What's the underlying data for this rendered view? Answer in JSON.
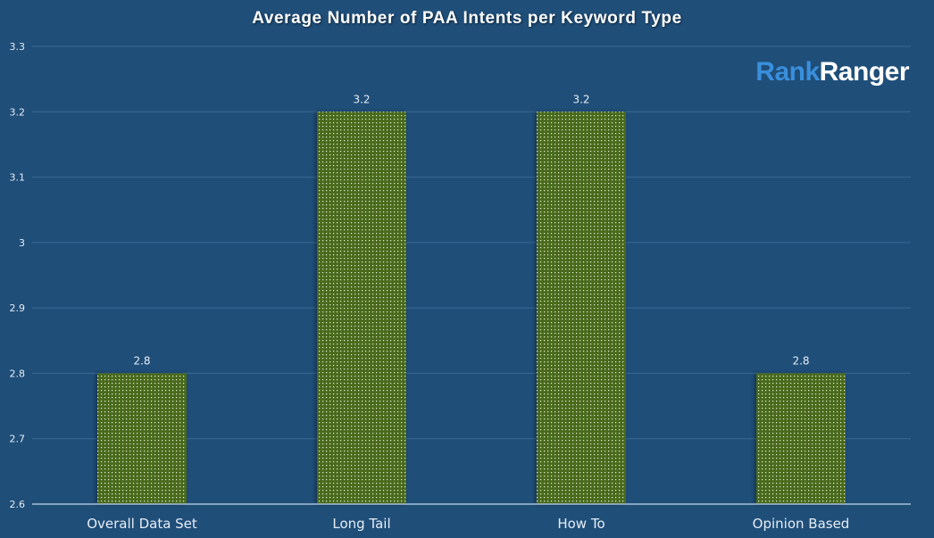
{
  "logo": {
    "part1": "Rank",
    "part2": "Ranger"
  },
  "colors": {
    "background": "#1f4e79",
    "bar_fill": "#4a6b1f",
    "bar_dot": "#e8f0d8",
    "gridline": "#3c6a96",
    "baseline": "#a9bfd6"
  },
  "chart_data": {
    "type": "bar",
    "title": "Average Number of PAA Intents per Keyword Type",
    "xlabel": "",
    "ylabel": "",
    "categories": [
      "Overall Data Set",
      "Long Tail",
      "How To",
      "Opinion Based"
    ],
    "values": [
      2.8,
      3.2,
      3.2,
      2.8
    ],
    "data_labels": [
      "2.8",
      "3.2",
      "3.2",
      "2.8"
    ],
    "ylim": [
      2.6,
      3.3
    ],
    "yticks": [
      2.6,
      2.7,
      2.8,
      2.9,
      3,
      3.1,
      3.2,
      3.3
    ],
    "ytick_labels": [
      "2.6",
      "2.7",
      "2.8",
      "2.9",
      "3",
      "3.1",
      "3.2",
      "3.3"
    ],
    "grid": true,
    "legend": "none"
  }
}
